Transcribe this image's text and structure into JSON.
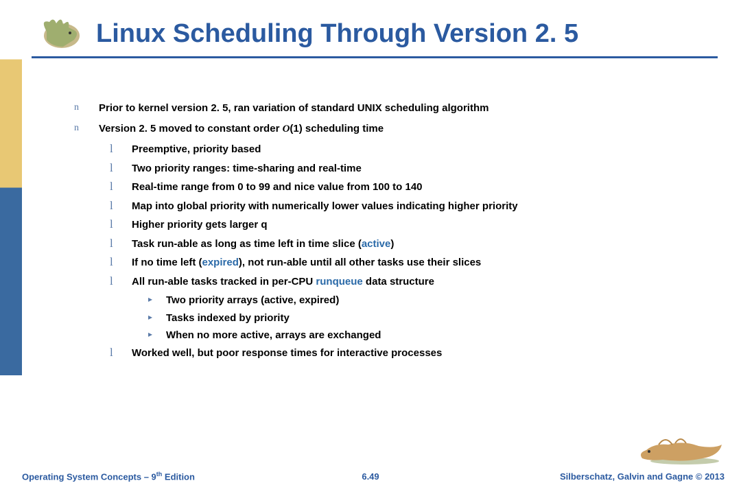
{
  "title": "Linux Scheduling Through Version 2. 5",
  "bullets": {
    "b1": "Prior to kernel version 2. 5, ran variation of standard UNIX scheduling algorithm",
    "b2_pre": "Version 2. 5 moved to constant order ",
    "b2_o1": "O",
    "b2_o1paren": "(1) scheduling time",
    "s1": "Preemptive, priority based",
    "s2": "Two priority ranges: time-sharing and real-time",
    "s3_a": "Real-time ",
    "s3_b": "range from 0 to 99 and ",
    "s3_c": "nice ",
    "s3_d": "value from 100 to 140",
    "s4": "Map into  global priority with numerically lower values indicating higher priority",
    "s5": "Higher priority gets larger q",
    "s6_a": "Task run-able as long as time left in time slice (",
    "s6_b": "active",
    "s6_c": ")",
    "s7_a": "If no time left (",
    "s7_b": "expired",
    "s7_c": "), not run-able until all other tasks use their slices",
    "s8_a": "All run-able tasks tracked in per-CPU ",
    "s8_b": "runqueue",
    "s8_c": " data structure",
    "t1": "Two priority arrays (active, expired)",
    "t2": "Tasks indexed by priority",
    "t3": "When no more active, arrays are exchanged",
    "s9": "Worked well, but poor response times for interactive processes"
  },
  "footer": {
    "left_a": "Operating System Concepts – 9",
    "left_sup": "th",
    "left_b": " Edition",
    "center": "6.49",
    "right": "Silberschatz, Galvin and Gagne © 2013"
  }
}
